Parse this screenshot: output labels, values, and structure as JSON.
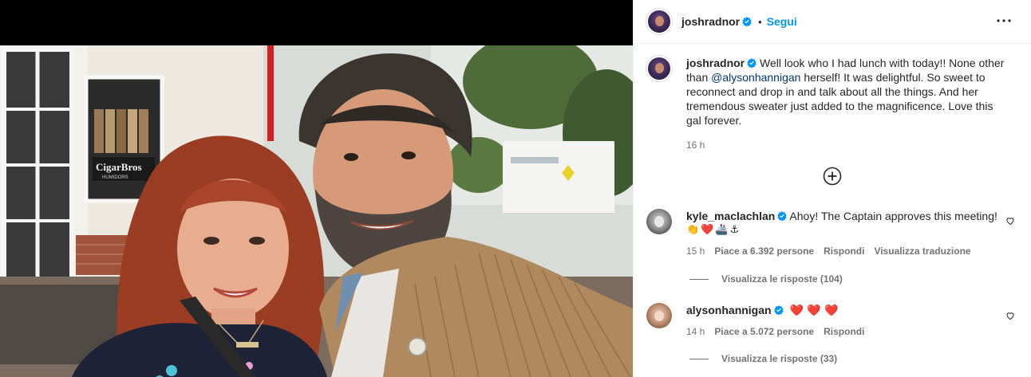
{
  "post": {
    "author": "joshradnor",
    "follow_label": "Segui",
    "separator": "•",
    "caption": {
      "author": "joshradnor",
      "text_before": "Well look who I had lunch with today!! None other than ",
      "mention": "@alysonhannigan",
      "text_after": " herself! It was delightful. So sweet to reconnect and drop in and talk about all the things. And her tremendous sweater just added to the magnificence. Love this gal forever.",
      "time": "16 h"
    },
    "photo_store_sign": "CigarBros",
    "photo_store_sub": "HUMIDORS"
  },
  "comments": [
    {
      "author": "kyle_maclachlan",
      "text": "Ahoy! The Captain approves this meeting!",
      "emojis": "👏❤️🚢⚓",
      "time": "15 h",
      "likes": "Piace a 6.392 persone",
      "reply": "Rispondi",
      "translate": "Visualizza traduzione",
      "view_replies": "Visualizza le risposte (104)"
    },
    {
      "author": "alysonhannigan",
      "text": "❤️ ❤️ ❤️",
      "time": "14 h",
      "likes": "Piace a 5.072 persone",
      "reply": "Rispondi",
      "view_replies": "Visualizza le risposte (33)"
    }
  ],
  "colors": {
    "accent": "#0095f6",
    "verified": "#0095f6",
    "muted": "#737373",
    "mention": "#00376b"
  },
  "icons": [
    "verified-badge-icon",
    "more-options-icon",
    "load-more-comments-icon",
    "heart-icon"
  ]
}
